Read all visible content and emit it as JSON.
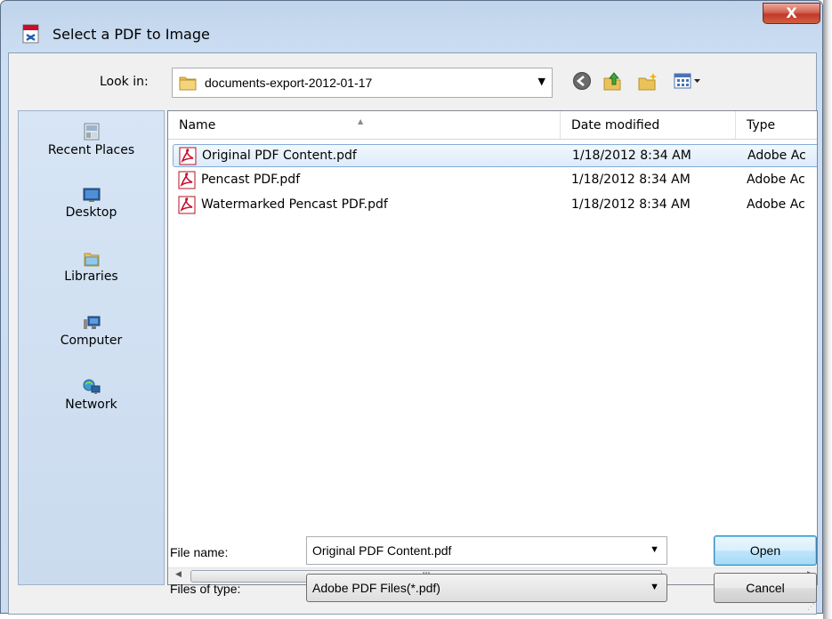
{
  "window": {
    "title": "Select a PDF to Image",
    "close_label": "X"
  },
  "lookin": {
    "label": "Look in:",
    "value": "documents-export-2012-01-17"
  },
  "toolbar": {
    "back_icon": "back-icon",
    "up_icon": "up-folder-icon",
    "newfolder_icon": "new-folder-icon",
    "views_icon": "views-menu-icon"
  },
  "places": [
    {
      "label": "Recent Places",
      "icon": "recent-places-icon"
    },
    {
      "label": "Desktop",
      "icon": "desktop-icon"
    },
    {
      "label": "Libraries",
      "icon": "libraries-icon"
    },
    {
      "label": "Computer",
      "icon": "computer-icon"
    },
    {
      "label": "Network",
      "icon": "network-icon"
    }
  ],
  "columns": {
    "name": "Name",
    "date": "Date modified",
    "type": "Type"
  },
  "files": [
    {
      "name": "Original PDF Content.pdf",
      "date": "1/18/2012 8:34 AM",
      "type": "Adobe Ac",
      "selected": true
    },
    {
      "name": "Pencast PDF.pdf",
      "date": "1/18/2012 8:34 AM",
      "type": "Adobe Ac",
      "selected": false
    },
    {
      "name": "Watermarked Pencast PDF.pdf",
      "date": "1/18/2012 8:34 AM",
      "type": "Adobe Ac",
      "selected": false
    }
  ],
  "scrollbar": {
    "thumb_grip": "III"
  },
  "filename": {
    "label": "File name:",
    "value": "Original PDF Content.pdf"
  },
  "filetype": {
    "label": "Files of type:",
    "value": "Adobe PDF Files(*.pdf)"
  },
  "buttons": {
    "open": "Open",
    "cancel": "Cancel"
  }
}
